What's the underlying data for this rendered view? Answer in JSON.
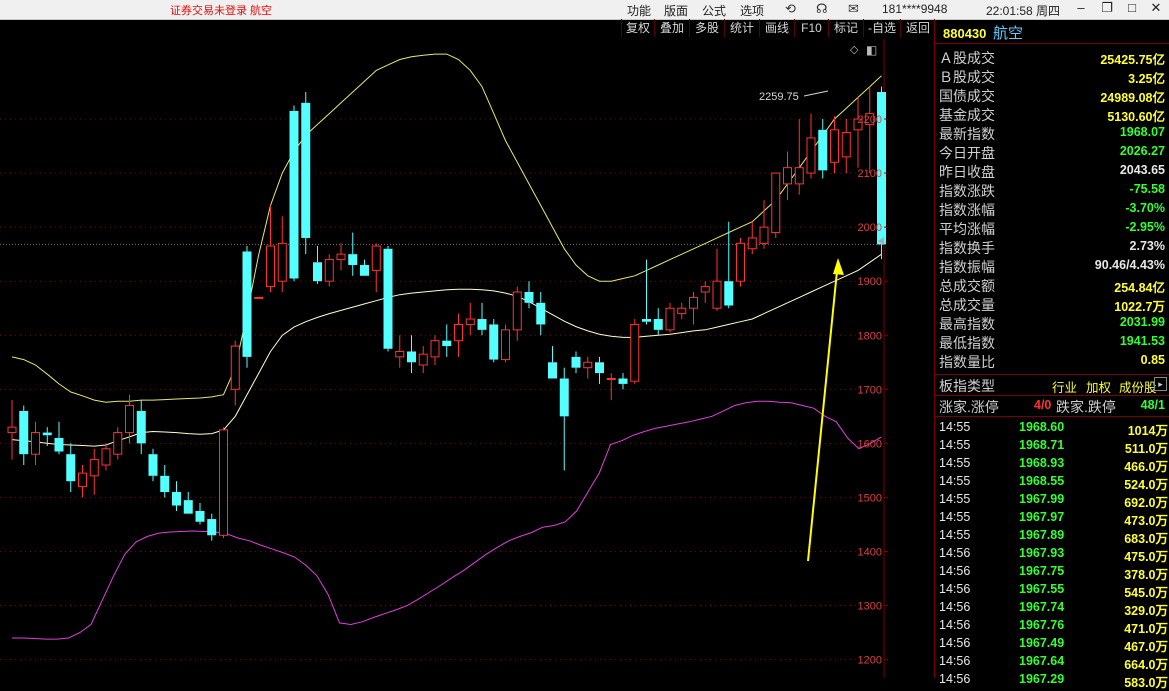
{
  "titlebar": {
    "notice": "证券交易未登录  航空",
    "menu": [
      "功能",
      "版面",
      "公式",
      "选项"
    ],
    "user": "181****9948",
    "clock": "22:01:58 周四",
    "icons": [
      "refresh-icon",
      "headset-icon",
      "mail-icon"
    ]
  },
  "toolbar": {
    "tabs": [
      "复权",
      "叠加",
      "多股",
      "统计",
      "画线",
      "F10",
      "标记",
      "-自选",
      "返回"
    ]
  },
  "colors": {
    "up": "#ff3232",
    "down": "#54ffff",
    "upper_band": "#e8e870",
    "lower_band": "#e040e0",
    "mid_band": "#ffffd0",
    "arrow": "#ffff00",
    "grid": "#800000"
  },
  "chart_data": {
    "type": "candlestick",
    "y_ticks": [
      "2200",
      "2100",
      "2000",
      "1900",
      "1800",
      "1700",
      "1600",
      "1500",
      "1400",
      "1300",
      "1200"
    ],
    "ylim": [
      1166,
      2348
    ],
    "high_label": "2259.75",
    "last_close": 1968.07,
    "candles": [
      {
        "o": 1620,
        "h": 1680,
        "l": 1570,
        "c": 1630
      },
      {
        "o": 1660,
        "h": 1670,
        "l": 1560,
        "c": 1580
      },
      {
        "o": 1580,
        "h": 1640,
        "l": 1560,
        "c": 1620
      },
      {
        "o": 1620,
        "h": 1630,
        "l": 1595,
        "c": 1615
      },
      {
        "o": 1610,
        "h": 1640,
        "l": 1580,
        "c": 1585
      },
      {
        "o": 1580,
        "h": 1600,
        "l": 1510,
        "c": 1530
      },
      {
        "o": 1520,
        "h": 1560,
        "l": 1500,
        "c": 1545
      },
      {
        "o": 1540,
        "h": 1590,
        "l": 1505,
        "c": 1570
      },
      {
        "o": 1560,
        "h": 1600,
        "l": 1550,
        "c": 1590
      },
      {
        "o": 1580,
        "h": 1630,
        "l": 1570,
        "c": 1620
      },
      {
        "o": 1620,
        "h": 1690,
        "l": 1600,
        "c": 1670
      },
      {
        "o": 1660,
        "h": 1680,
        "l": 1580,
        "c": 1600
      },
      {
        "o": 1580,
        "h": 1590,
        "l": 1530,
        "c": 1540
      },
      {
        "o": 1540,
        "h": 1560,
        "l": 1500,
        "c": 1510
      },
      {
        "o": 1510,
        "h": 1530,
        "l": 1475,
        "c": 1485
      },
      {
        "o": 1495,
        "h": 1510,
        "l": 1470,
        "c": 1470
      },
      {
        "o": 1475,
        "h": 1490,
        "l": 1450,
        "c": 1455
      },
      {
        "o": 1460,
        "h": 1470,
        "l": 1420,
        "c": 1430
      },
      {
        "o": 1430,
        "h": 1630,
        "l": 1425,
        "c": 1625
      },
      {
        "o": 1700,
        "h": 1790,
        "l": 1670,
        "c": 1780
      },
      {
        "o": 1955,
        "h": 1965,
        "l": 1740,
        "c": 1760
      },
      {
        "o": 1870,
        "h": 1870,
        "l": 1870,
        "c": 1870
      },
      {
        "o": 1890,
        "h": 2040,
        "l": 1880,
        "c": 1965
      },
      {
        "o": 1900,
        "h": 2020,
        "l": 1880,
        "c": 1970
      },
      {
        "o": 2215,
        "h": 2225,
        "l": 1900,
        "c": 1905
      },
      {
        "o": 2230,
        "h": 2250,
        "l": 1950,
        "c": 1980
      },
      {
        "o": 1935,
        "h": 1965,
        "l": 1895,
        "c": 1900
      },
      {
        "o": 1900,
        "h": 1950,
        "l": 1890,
        "c": 1940
      },
      {
        "o": 1940,
        "h": 1970,
        "l": 1920,
        "c": 1950
      },
      {
        "o": 1950,
        "h": 1990,
        "l": 1910,
        "c": 1930
      },
      {
        "o": 1930,
        "h": 1940,
        "l": 1910,
        "c": 1910
      },
      {
        "o": 1920,
        "h": 1970,
        "l": 1880,
        "c": 1965
      },
      {
        "o": 1960,
        "h": 1965,
        "l": 1770,
        "c": 1775
      },
      {
        "o": 1760,
        "h": 1800,
        "l": 1740,
        "c": 1770
      },
      {
        "o": 1770,
        "h": 1800,
        "l": 1730,
        "c": 1750
      },
      {
        "o": 1745,
        "h": 1780,
        "l": 1730,
        "c": 1765
      },
      {
        "o": 1760,
        "h": 1800,
        "l": 1745,
        "c": 1790
      },
      {
        "o": 1790,
        "h": 1820,
        "l": 1760,
        "c": 1780
      },
      {
        "o": 1790,
        "h": 1840,
        "l": 1760,
        "c": 1820
      },
      {
        "o": 1820,
        "h": 1860,
        "l": 1800,
        "c": 1830
      },
      {
        "o": 1830,
        "h": 1860,
        "l": 1800,
        "c": 1810
      },
      {
        "o": 1820,
        "h": 1830,
        "l": 1750,
        "c": 1755
      },
      {
        "o": 1755,
        "h": 1820,
        "l": 1750,
        "c": 1810
      },
      {
        "o": 1810,
        "h": 1890,
        "l": 1790,
        "c": 1880
      },
      {
        "o": 1880,
        "h": 1900,
        "l": 1850,
        "c": 1860
      },
      {
        "o": 1860,
        "h": 1880,
        "l": 1800,
        "c": 1820
      },
      {
        "o": 1750,
        "h": 1780,
        "l": 1720,
        "c": 1720
      },
      {
        "o": 1720,
        "h": 1740,
        "l": 1550,
        "c": 1650
      },
      {
        "o": 1760,
        "h": 1770,
        "l": 1730,
        "c": 1740
      },
      {
        "o": 1740,
        "h": 1760,
        "l": 1720,
        "c": 1750
      },
      {
        "o": 1750,
        "h": 1760,
        "l": 1710,
        "c": 1730
      },
      {
        "o": 1720,
        "h": 1730,
        "l": 1680,
        "c": 1720
      },
      {
        "o": 1720,
        "h": 1730,
        "l": 1700,
        "c": 1710
      },
      {
        "o": 1715,
        "h": 1830,
        "l": 1710,
        "c": 1820
      },
      {
        "o": 1830,
        "h": 1940,
        "l": 1820,
        "c": 1825
      },
      {
        "o": 1830,
        "h": 1850,
        "l": 1800,
        "c": 1810
      },
      {
        "o": 1810,
        "h": 1860,
        "l": 1805,
        "c": 1850
      },
      {
        "o": 1840,
        "h": 1860,
        "l": 1830,
        "c": 1850
      },
      {
        "o": 1850,
        "h": 1880,
        "l": 1820,
        "c": 1870
      },
      {
        "o": 1880,
        "h": 1900,
        "l": 1860,
        "c": 1890
      },
      {
        "o": 1850,
        "h": 1960,
        "l": 1845,
        "c": 1900
      },
      {
        "o": 1900,
        "h": 2010,
        "l": 1850,
        "c": 1855
      },
      {
        "o": 1900,
        "h": 1980,
        "l": 1890,
        "c": 1970
      },
      {
        "o": 1960,
        "h": 2010,
        "l": 1950,
        "c": 1980
      },
      {
        "o": 1970,
        "h": 2050,
        "l": 1960,
        "c": 2000
      },
      {
        "o": 1990,
        "h": 2100,
        "l": 1980,
        "c": 2100
      },
      {
        "o": 2080,
        "h": 2140,
        "l": 2050,
        "c": 2110
      },
      {
        "o": 2080,
        "h": 2200,
        "l": 2060,
        "c": 2110
      },
      {
        "o": 2100,
        "h": 2210,
        "l": 2090,
        "c": 2165
      },
      {
        "o": 2180,
        "h": 2200,
        "l": 2090,
        "c": 2105
      },
      {
        "o": 2120,
        "h": 2205,
        "l": 2100,
        "c": 2180
      },
      {
        "o": 2130,
        "h": 2200,
        "l": 2100,
        "c": 2175
      },
      {
        "o": 2180,
        "h": 2240,
        "l": 2110,
        "c": 2200
      },
      {
        "o": 2190,
        "h": 2260,
        "l": 2100,
        "c": 2210
      },
      {
        "o": 2250,
        "h": 2260,
        "l": 1941,
        "c": 1968
      }
    ],
    "upper_band": [
      1760,
      1755,
      1745,
      1728,
      1710,
      1695,
      1688,
      1680,
      1676,
      1678,
      1678,
      1680,
      1680,
      1681,
      1682,
      1683,
      1684,
      1686,
      1690,
      1740,
      1840,
      1950,
      2040,
      2100,
      2140,
      2170,
      2190,
      2210,
      2230,
      2250,
      2270,
      2290,
      2300,
      2310,
      2315,
      2318,
      2320,
      2320,
      2310,
      2290,
      2260,
      2210,
      2160,
      2120,
      2080,
      2040,
      2000,
      1960,
      1930,
      1910,
      1900,
      1900,
      1905,
      1910,
      1920,
      1930,
      1940,
      1950,
      1960,
      1970,
      1980,
      1990,
      2000,
      2010,
      2030,
      2050,
      2080,
      2110,
      2140,
      2170,
      2200,
      2220,
      2240,
      2260,
      2280
    ],
    "mid_band": [
      1607,
      1605,
      1603,
      1600,
      1598,
      1597,
      1596,
      1595,
      1597,
      1605,
      1612,
      1620,
      1622,
      1621,
      1620,
      1618,
      1617,
      1618,
      1625,
      1650,
      1690,
      1730,
      1770,
      1800,
      1815,
      1825,
      1833,
      1840,
      1846,
      1852,
      1858,
      1864,
      1870,
      1875,
      1878,
      1880,
      1882,
      1884,
      1885,
      1885,
      1884,
      1882,
      1878,
      1872,
      1862,
      1850,
      1838,
      1826,
      1816,
      1808,
      1802,
      1798,
      1796,
      1796,
      1798,
      1800,
      1802,
      1805,
      1808,
      1810,
      1815,
      1820,
      1825,
      1830,
      1840,
      1850,
      1860,
      1870,
      1880,
      1890,
      1900,
      1910,
      1920,
      1935,
      1950
    ],
    "lower_band": [
      1240,
      1240,
      1239,
      1238,
      1238,
      1240,
      1250,
      1265,
      1310,
      1355,
      1395,
      1418,
      1428,
      1434,
      1436,
      1437,
      1438,
      1437,
      1436,
      1433,
      1425,
      1420,
      1412,
      1405,
      1398,
      1390,
      1375,
      1355,
      1320,
      1268,
      1265,
      1270,
      1278,
      1285,
      1292,
      1300,
      1312,
      1325,
      1338,
      1352,
      1365,
      1380,
      1395,
      1408,
      1420,
      1428,
      1435,
      1445,
      1448,
      1455,
      1475,
      1510,
      1545,
      1598,
      1605,
      1615,
      1622,
      1628,
      1632,
      1636,
      1640,
      1645,
      1650,
      1660,
      1670,
      1675,
      1678,
      1678,
      1676,
      1675,
      1670,
      1665,
      1650,
      1640,
      1610,
      1590,
      1600,
      1612
    ]
  },
  "stock": {
    "code": "880430",
    "name": "航空",
    "stats": [
      {
        "label": "Ａ股成交",
        "value": "25425.75亿",
        "color": "#ffff33"
      },
      {
        "label": "Ｂ股成交",
        "value": "3.25亿",
        "color": "#ffff33"
      },
      {
        "label": "国债成交",
        "value": "24989.08亿",
        "color": "#ffff33"
      },
      {
        "label": "基金成交",
        "value": "5130.60亿",
        "color": "#ffff33"
      },
      {
        "label": "最新指数",
        "value": "1968.07",
        "color": "#33ff33"
      },
      {
        "label": "今日开盘",
        "value": "2026.27",
        "color": "#33ff33"
      },
      {
        "label": "昨日收盘",
        "value": "2043.65",
        "color": "#e8e8e8"
      },
      {
        "label": "指数涨跌",
        "value": "-75.58",
        "color": "#33ff33"
      },
      {
        "label": "指数涨幅",
        "value": "-3.70%",
        "color": "#33ff33"
      },
      {
        "label": "平均涨幅",
        "value": "-2.95%",
        "color": "#33ff33"
      },
      {
        "label": "指数换手",
        "value": "2.73%",
        "color": "#e8e8e8"
      },
      {
        "label": "指数振幅",
        "value": "90.46/4.43%",
        "color": "#e8e8e8"
      },
      {
        "label": "总成交额",
        "value": "254.84亿",
        "color": "#ffff33"
      },
      {
        "label": "总成交量",
        "value": "1022.7万",
        "color": "#ffff33"
      },
      {
        "label": "最高指数",
        "value": "2031.99",
        "color": "#33ff33"
      },
      {
        "label": "最低指数",
        "value": "1941.53",
        "color": "#33ff33"
      },
      {
        "label": "指数量比",
        "value": "0.85",
        "color": "#ffff33"
      }
    ],
    "type_row": {
      "label": "板指类型",
      "tags": [
        "行业",
        "加权",
        "成份股"
      ]
    },
    "breadth": {
      "up_label": "涨家.涨停",
      "up_val": "4/0",
      "down_label": "跌家.跌停",
      "down_val": "48/1"
    },
    "ticks": [
      {
        "t": "14:55",
        "p": "1968.60",
        "v": "1014万"
      },
      {
        "t": "14:55",
        "p": "1968.71",
        "v": "511.0万"
      },
      {
        "t": "14:55",
        "p": "1968.93",
        "v": "466.0万"
      },
      {
        "t": "14:55",
        "p": "1968.55",
        "v": "524.0万"
      },
      {
        "t": "14:55",
        "p": "1967.99",
        "v": "692.0万"
      },
      {
        "t": "14:55",
        "p": "1967.97",
        "v": "473.0万"
      },
      {
        "t": "14:55",
        "p": "1967.89",
        "v": "683.0万"
      },
      {
        "t": "14:56",
        "p": "1967.93",
        "v": "475.0万"
      },
      {
        "t": "14:56",
        "p": "1967.75",
        "v": "378.0万"
      },
      {
        "t": "14:56",
        "p": "1967.55",
        "v": "545.0万"
      },
      {
        "t": "14:56",
        "p": "1967.74",
        "v": "329.0万"
      },
      {
        "t": "14:56",
        "p": "1967.76",
        "v": "471.0万"
      },
      {
        "t": "14:56",
        "p": "1967.49",
        "v": "467.0万"
      },
      {
        "t": "14:56",
        "p": "1967.64",
        "v": "664.0万"
      },
      {
        "t": "14:56",
        "p": "1967.29",
        "v": "583.0万"
      }
    ]
  }
}
